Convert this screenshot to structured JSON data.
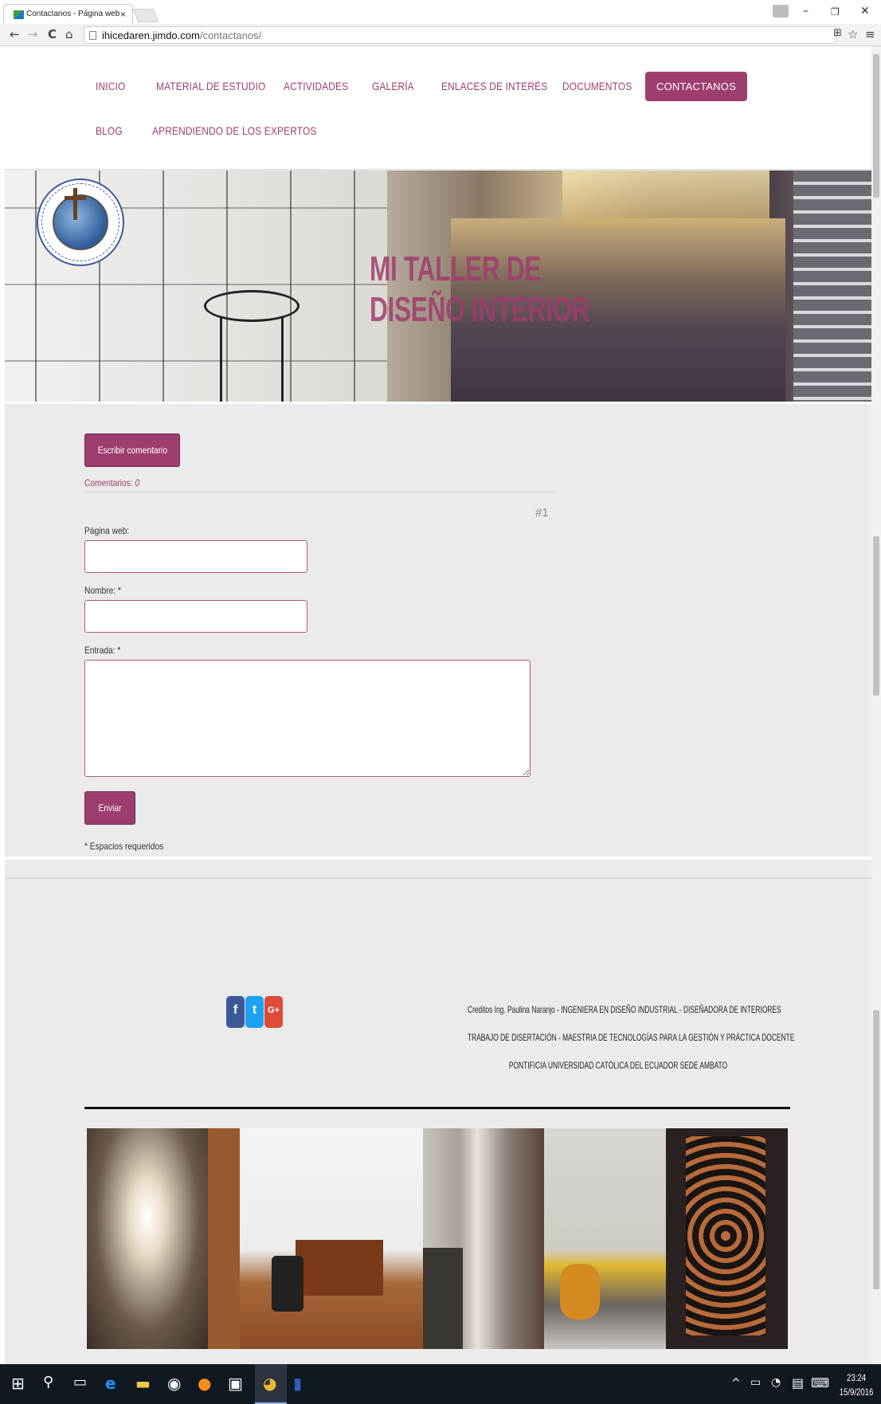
{
  "browser": {
    "tab_title": "Contactanos - Página web",
    "tab_close": "×",
    "url_domain": "ihicedaren.jimdo.com",
    "url_path": "/contactanos/",
    "back": "←",
    "forward": "→",
    "reload": "C",
    "home": "⌂",
    "minimize": "–",
    "maximize": "❐",
    "close": "✕",
    "star": "☆",
    "menu": "≡",
    "translate": "⊞"
  },
  "nav": {
    "items": [
      {
        "label": "INICIO"
      },
      {
        "label": "MATERIAL DE ESTUDIO"
      },
      {
        "label": "ACTIVIDADES"
      },
      {
        "label": "GALERÍA"
      },
      {
        "label": "ENLACES DE INTERÉS"
      },
      {
        "label": "DOCUMENTOS"
      },
      {
        "label": "CONTACTANOS",
        "active": true
      },
      {
        "label": "BLOG"
      },
      {
        "label": "APRENDIENDO DE LOS EXPERTOS"
      }
    ]
  },
  "hero": {
    "title_line1": "MI TALLER DE",
    "title_line2": "DISEÑO INTERIOR",
    "logo_text_top": "PONTIFICIA UNIVERSIDAD CATÓLICA DEL ECUADOR SEDE AMBATO",
    "logo_text_bottom": "SERÉIS MIS TESTIGOS"
  },
  "comments": {
    "write_button": "Escribir comentario",
    "count_label": "Comentarios:",
    "count_value": "0",
    "entry_number": "#1",
    "website_label": "Página web:",
    "name_label": "Nombre: *",
    "entry_label": "Entrada: *",
    "website_value": "",
    "name_value": "",
    "entry_value": "",
    "submit_button": "Enviar",
    "required_note": "* Espacios requeridos"
  },
  "footer": {
    "social": [
      {
        "name": "facebook",
        "glyph": "f"
      },
      {
        "name": "twitter",
        "glyph": "t"
      },
      {
        "name": "google-plus",
        "glyph": "G+"
      }
    ],
    "credit_line1": "Creditos Ing. Paulina Naranjo - INGENIERA EN DISEÑO INDUSTRIAL - DISEÑADORA DE INTERIORES",
    "credit_line2": "TRABAJO DE DISERTACIÓN - MAESTRIA DE TECNOLOGÍAS PARA LA GESTIÓN Y PRÁCTICA DOCENTE",
    "credit_line3": "PONTIFICIA UNIVERSIDAD CATÓLICA DEL ECUADOR SEDE AMBATO"
  },
  "taskbar": {
    "time": "23:24",
    "date": "15/9/2016"
  },
  "colors": {
    "accent": "#9e3e6e",
    "page_bg": "#ebebeb",
    "taskbar": "#101820"
  }
}
